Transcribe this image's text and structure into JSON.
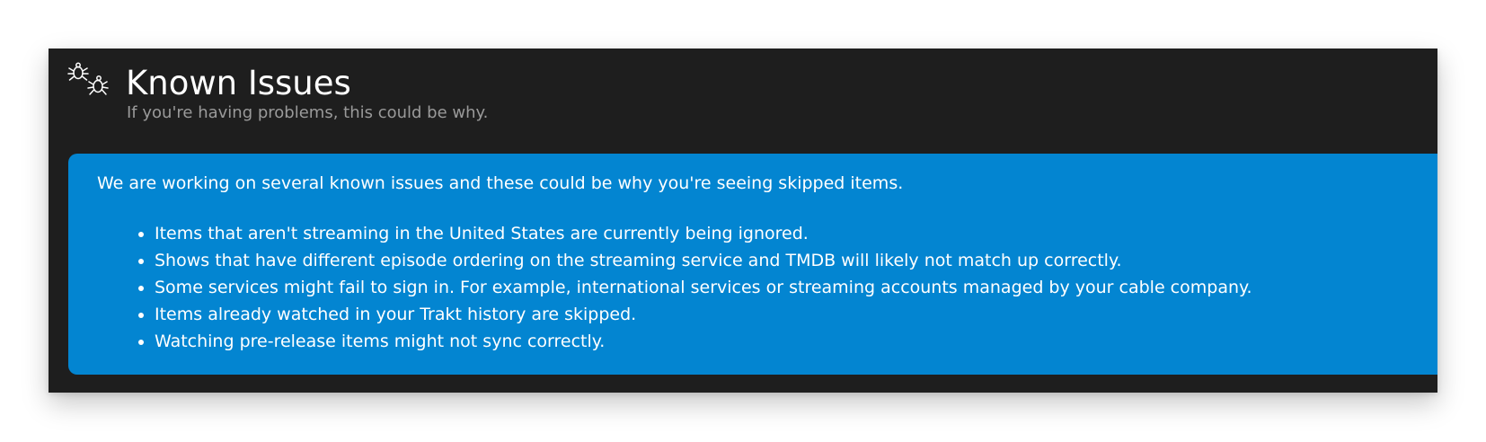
{
  "header": {
    "icon": "bugs-icon",
    "title": "Known Issues",
    "subtitle": "If you're having problems, this could be why."
  },
  "notice": {
    "background_color": "#0385d1",
    "intro": "We are working on several known issues and these could be why you're seeing skipped items.",
    "items": [
      "Items that aren't streaming in the United States are currently being ignored.",
      "Shows that have different episode ordering on the streaming service and TMDB will likely not match up correctly.",
      "Some services might fail to sign in. For example, international services or streaming accounts managed by your cable company.",
      "Items already watched in your Trakt history are skipped.",
      "Watching pre-release items might not sync correctly."
    ]
  },
  "colors": {
    "panel_background": "#1e1e1e",
    "page_background": "#ffffff",
    "title_text": "#ffffff",
    "subtitle_text": "#9a9a9a"
  }
}
